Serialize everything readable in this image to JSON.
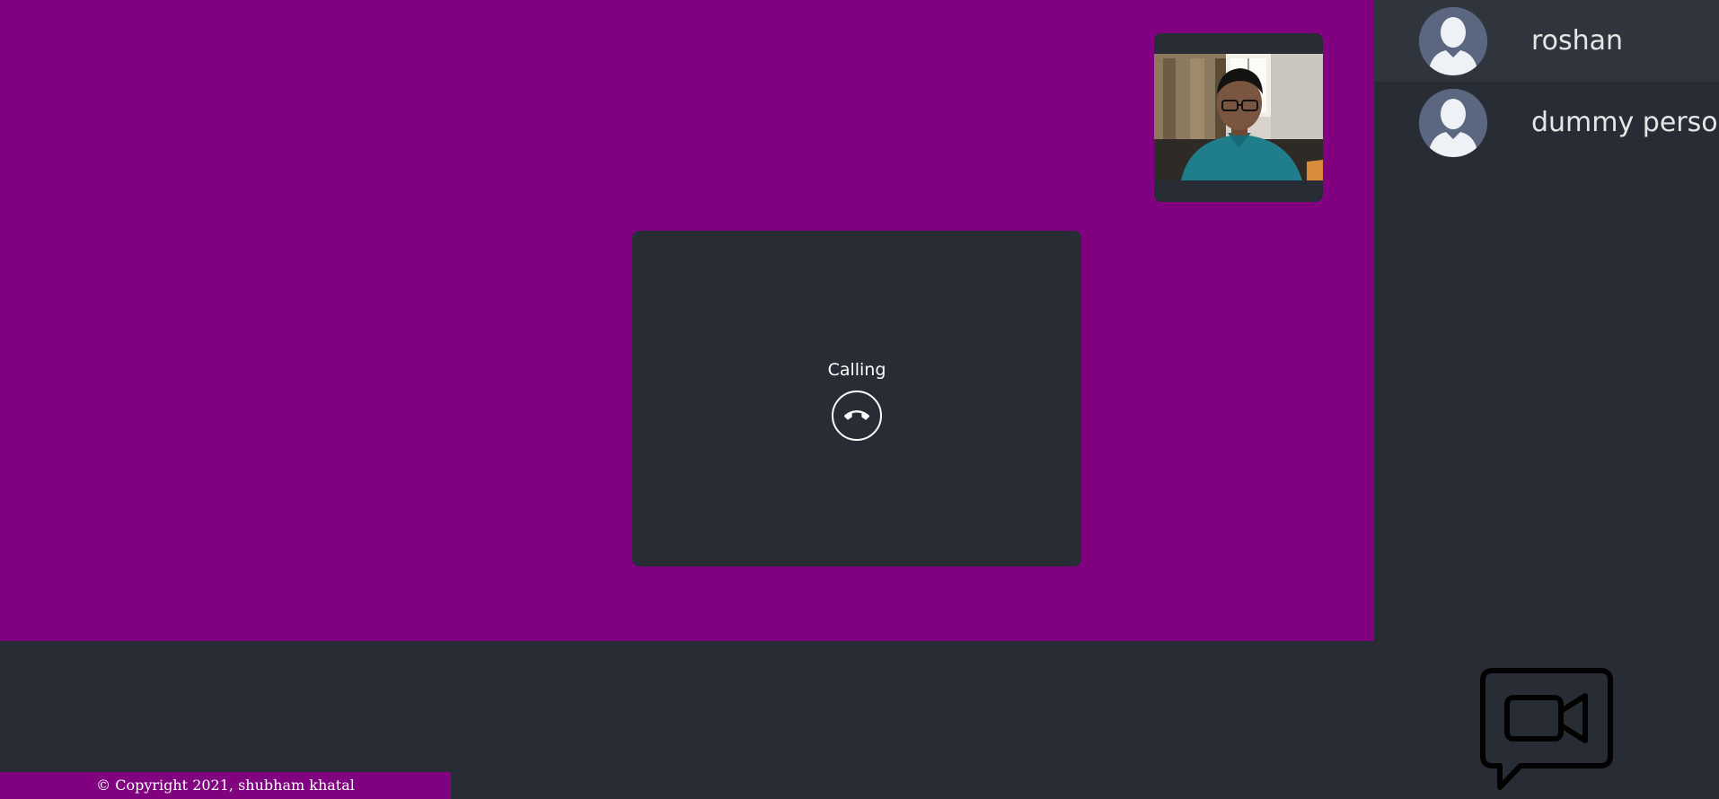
{
  "call": {
    "status_text": "Calling",
    "hangup_icon": "phone-hangup-icon"
  },
  "contacts": [
    {
      "name": "roshan",
      "avatar": "default-user-avatar",
      "active": true
    },
    {
      "name": "dummy person",
      "avatar": "default-user-avatar",
      "active": false
    }
  ],
  "footer": {
    "copyright": "© Copyright 2021, shubham khatal"
  },
  "colors": {
    "video_area_bg": "#800080",
    "dark_bg": "#282d35",
    "active_contact_bg": "#30353d",
    "avatar_bg": "#5b6781",
    "text": "#ffffff"
  },
  "logo": {
    "icon": "video-chat-logo-icon"
  }
}
